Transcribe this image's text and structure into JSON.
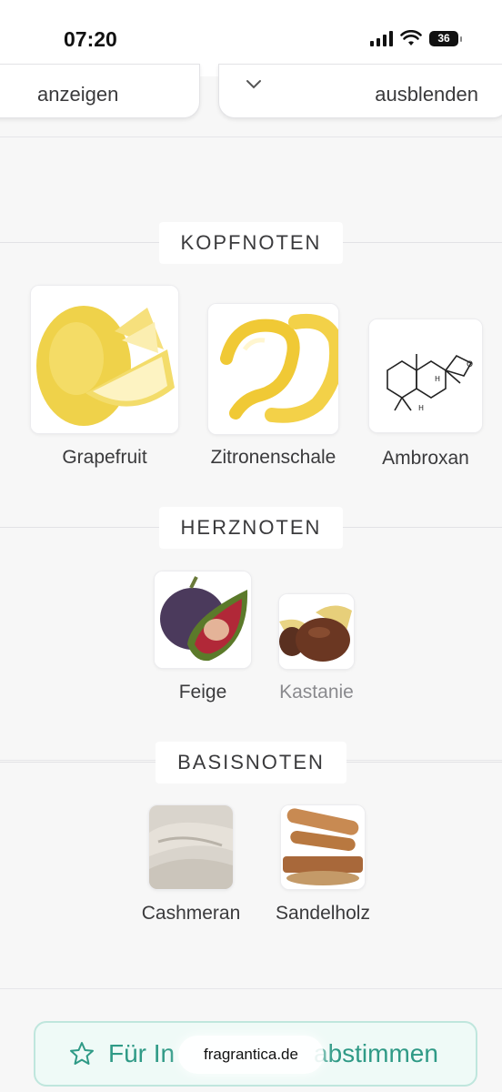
{
  "status_bar": {
    "time": "07:20",
    "battery": "36"
  },
  "toggles": {
    "show_label": "anzeigen",
    "hide_label": "ausblenden"
  },
  "sections": {
    "top": {
      "title": "KOPFNOTEN",
      "notes": [
        {
          "name": "Grapefruit",
          "icon": "grapefruit-image"
        },
        {
          "name": "Zitronenschale",
          "icon": "lemon-peel-image"
        },
        {
          "name": "Ambroxan",
          "icon": "ambroxan-molecule-image"
        }
      ]
    },
    "heart": {
      "title": "HERZNOTEN",
      "notes": [
        {
          "name": "Feige",
          "icon": "fig-image"
        },
        {
          "name": "Kastanie",
          "icon": "chestnut-image"
        }
      ]
    },
    "base": {
      "title": "BASISNOTEN",
      "notes": [
        {
          "name": "Cashmeran",
          "icon": "cashmere-fabric-image"
        },
        {
          "name": "Sandelholz",
          "icon": "sandalwood-image"
        }
      ]
    }
  },
  "vote_button": {
    "label_start": "Für In",
    "label_end": "abstimmen"
  },
  "watermark": "fragrantica.de",
  "colors": {
    "accent": "#2f9a86",
    "accent_bg": "#effaf7"
  }
}
